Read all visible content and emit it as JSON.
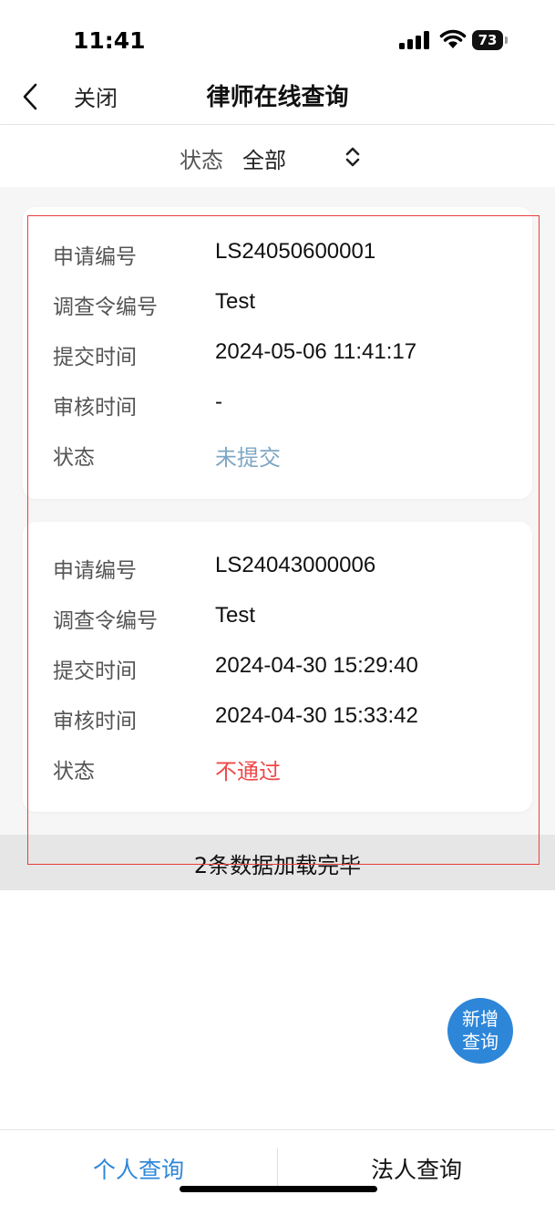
{
  "status_bar": {
    "time": "11:41",
    "battery": "73"
  },
  "nav": {
    "close_label": "关闭",
    "title": "律师在线查询"
  },
  "filter": {
    "label": "状态",
    "value": "全部"
  },
  "records": [
    {
      "fields": [
        {
          "label": "申请编号",
          "value": "LS24050600001"
        },
        {
          "label": "调查令编号",
          "value": "Test"
        },
        {
          "label": "提交时间",
          "value": "2024-05-06 11:41:17"
        },
        {
          "label": "审核时间",
          "value": "-"
        },
        {
          "label": "状态",
          "value": "未提交"
        }
      ]
    },
    {
      "fields": [
        {
          "label": "申请编号",
          "value": "LS24043000006"
        },
        {
          "label": "调查令编号",
          "value": "Test"
        },
        {
          "label": "提交时间",
          "value": "2024-04-30 15:29:40"
        },
        {
          "label": "审核时间",
          "value": "2024-04-30 15:33:42"
        },
        {
          "label": "状态",
          "value": "不通过"
        }
      ]
    }
  ],
  "load_status": "2条数据加载完毕",
  "fab": {
    "line1": "新增",
    "line2": "查询"
  },
  "tabs": {
    "personal": "个人查询",
    "corporate": "法人查询"
  },
  "colors": {
    "accent": "#2e86d8",
    "pending": "#7ea7c4",
    "rejected": "#f04848",
    "highlight_frame": "#e8403a"
  }
}
